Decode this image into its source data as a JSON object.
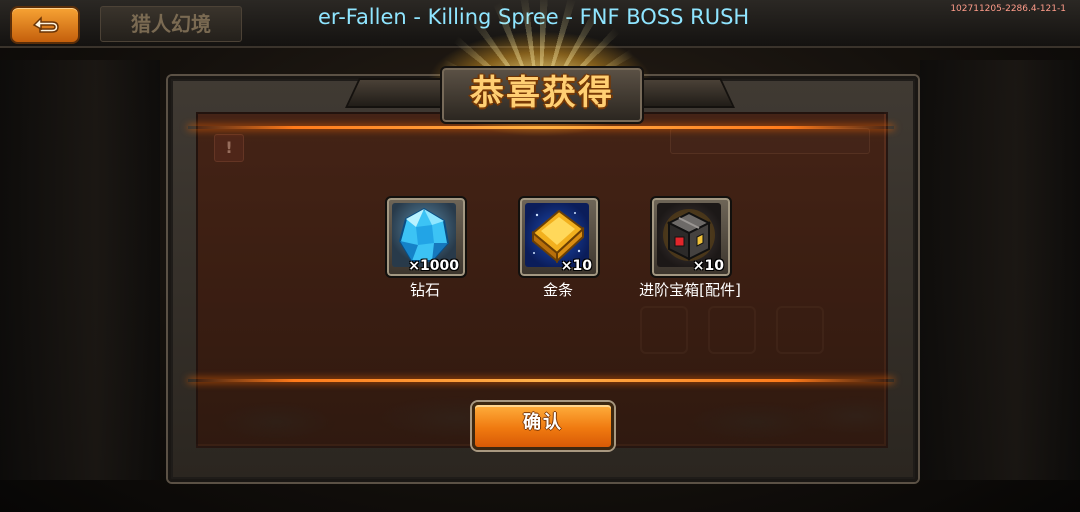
{
  "header": {
    "back_icon": "back-arrow-icon",
    "page_title": "猎人幻境",
    "overlay_title": "er-Fallen - Killing Spree - FNF BOSS RUSH",
    "build_info": "102711205-2286.4-121-1"
  },
  "dialog": {
    "title": "恭喜获得",
    "alert_icon": "!",
    "rewards": [
      {
        "name": "钻石",
        "count": "×1000",
        "icon": "diamond-icon"
      },
      {
        "name": "金条",
        "count": "×10",
        "icon": "gold-bar-icon"
      },
      {
        "name": "进阶宝箱[配件]",
        "count": "×10",
        "icon": "treasure-box-icon"
      }
    ],
    "confirm_label": "确认"
  },
  "colors": {
    "accent": "#f07a10",
    "title_gold": "#ffcf73",
    "overlay_text": "#8fe5ff"
  }
}
